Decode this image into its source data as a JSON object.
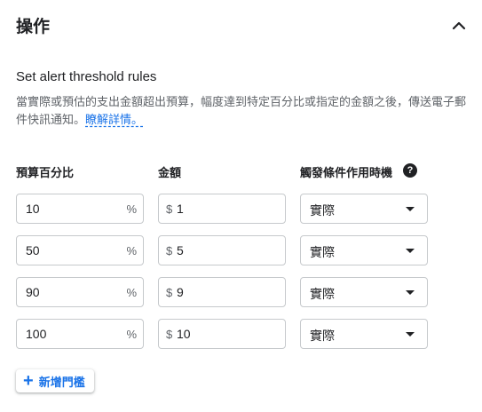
{
  "header": {
    "title": "操作",
    "collapse_icon": "chevron-up-icon"
  },
  "alert": {
    "section_title": "Set alert threshold rules",
    "description": "當實際或預估的支出金額超出預算，幅度達到特定百分比或指定的金額之後，傳送電子郵件快訊通知。",
    "learn_more": "瞭解詳情。"
  },
  "columns": {
    "percent": "預算百分比",
    "amount": "金額",
    "trigger": "觸發條件作用時機",
    "help_icon": "help-icon"
  },
  "symbols": {
    "percent": "%",
    "currency": "$"
  },
  "rows": [
    {
      "percent": "10",
      "amount": "1",
      "trigger": "實際"
    },
    {
      "percent": "50",
      "amount": "5",
      "trigger": "實際"
    },
    {
      "percent": "90",
      "amount": "9",
      "trigger": "實際"
    },
    {
      "percent": "100",
      "amount": "10",
      "trigger": "實際"
    }
  ],
  "add_button": {
    "label": "新增門檻",
    "icon": "plus-icon"
  },
  "colors": {
    "accent": "#1a73e8",
    "text": "#202124",
    "muted": "#5f6368",
    "border": "#c6c9cc"
  }
}
